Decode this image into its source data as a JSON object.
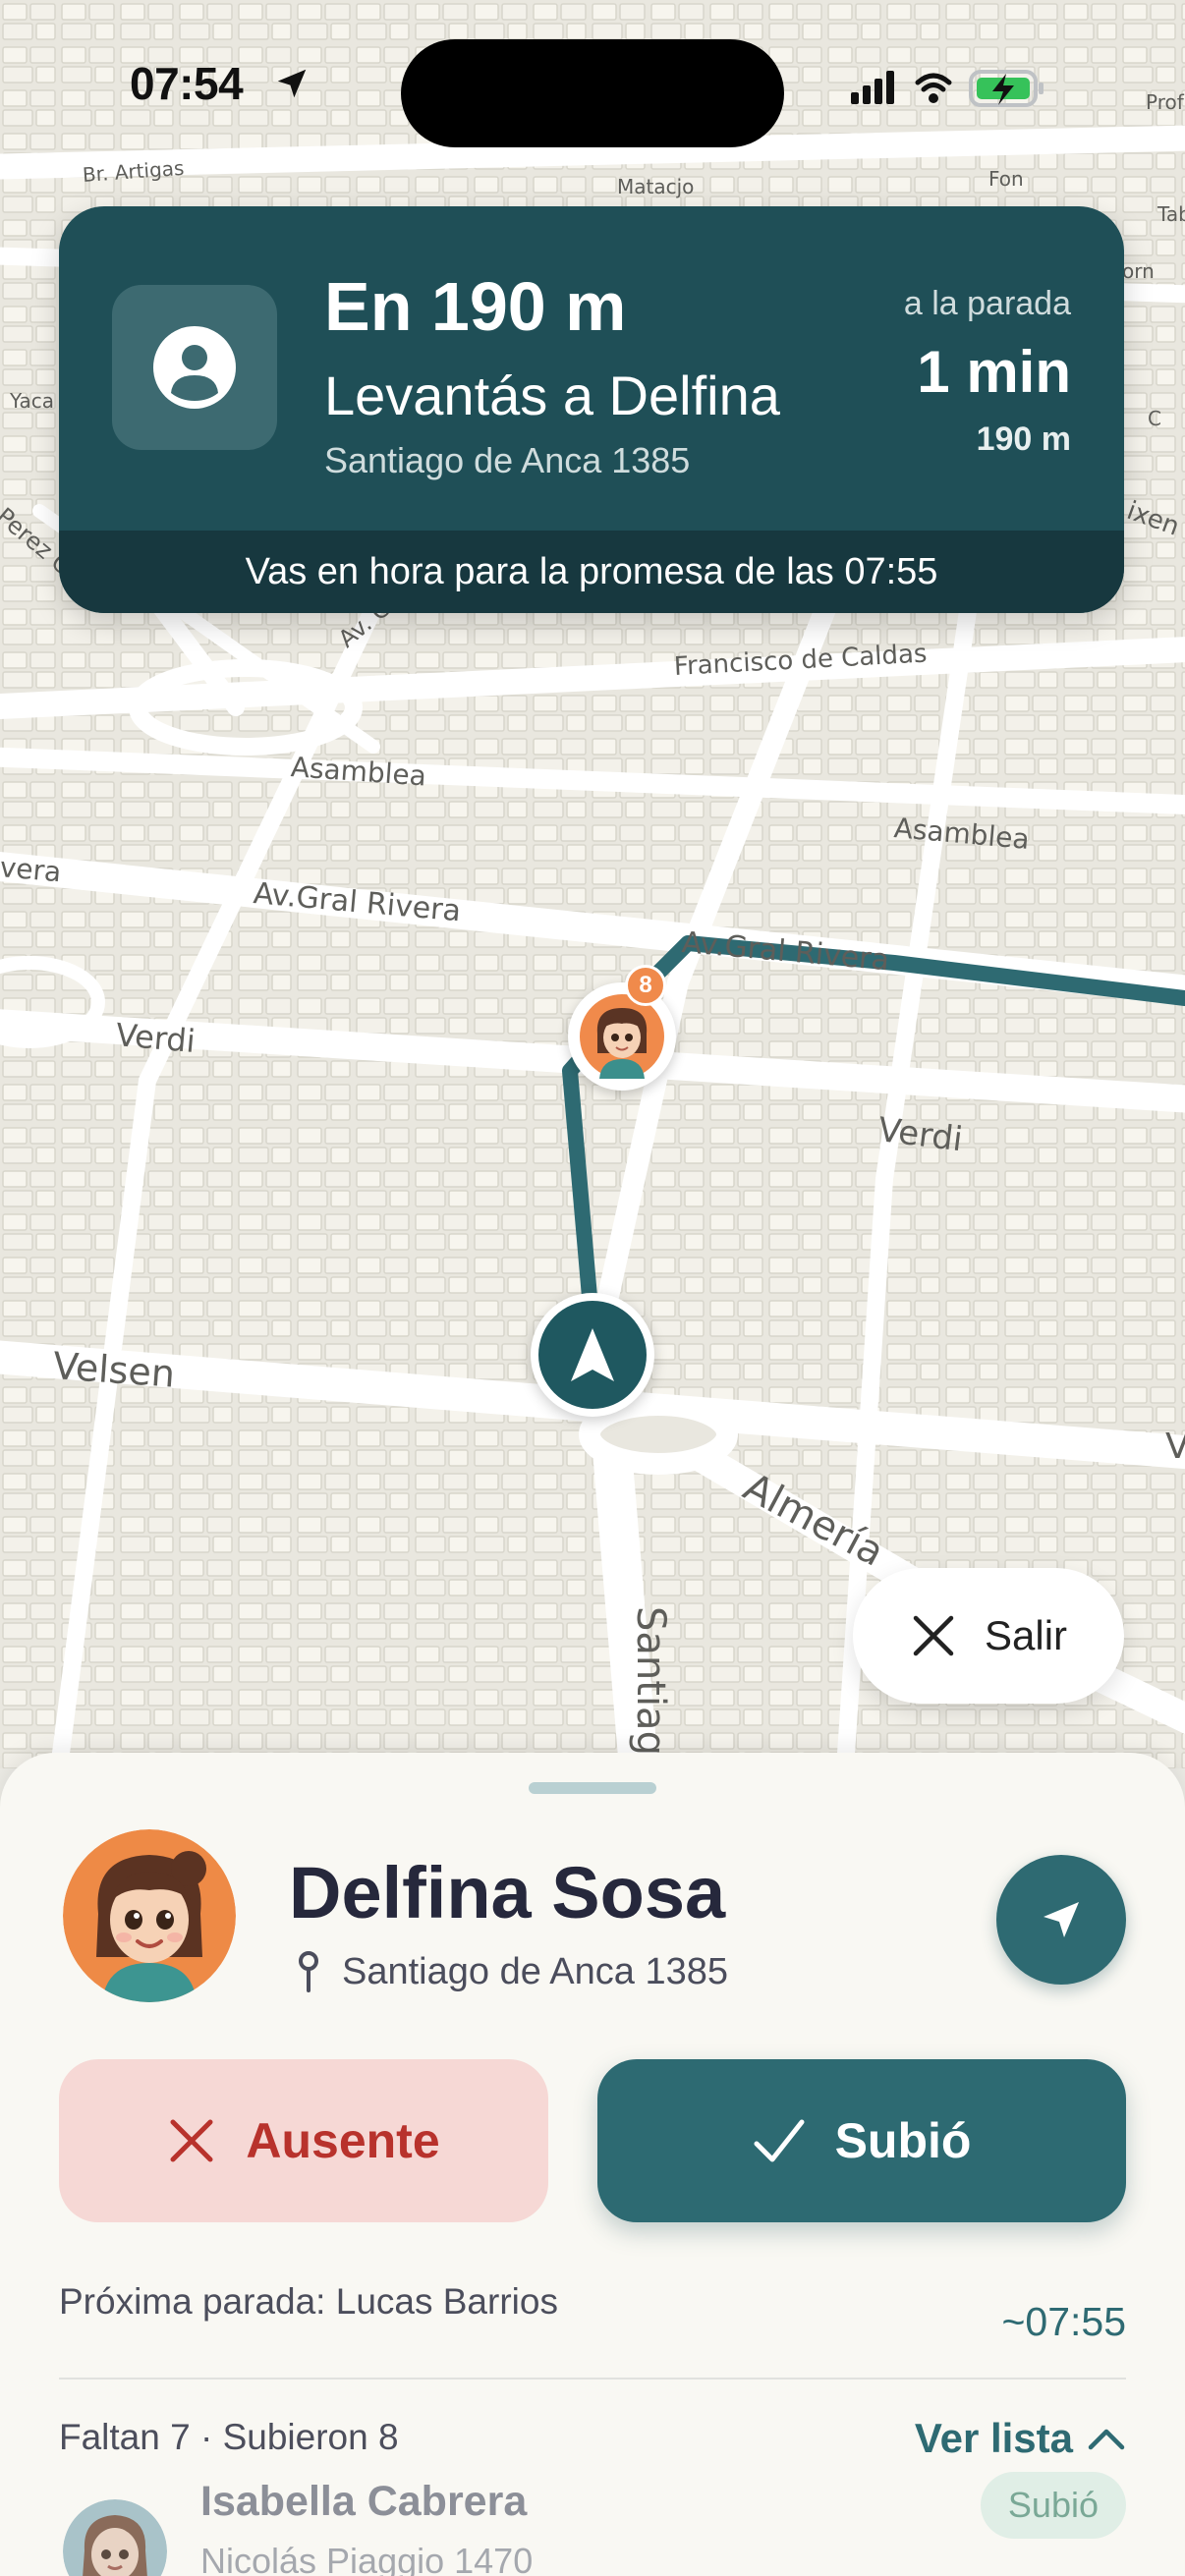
{
  "status_bar": {
    "time": "07:54"
  },
  "map": {
    "streets": [
      {
        "name": "Br. Artigas"
      },
      {
        "name": "Matacjo"
      },
      {
        "name": "Yaca"
      },
      {
        "name": "Perez C"
      },
      {
        "name": "orn"
      },
      {
        "name": "C"
      },
      {
        "name": "Tab"
      },
      {
        "name": "Fon"
      },
      {
        "name": "Prof"
      },
      {
        "name": "ixen"
      },
      {
        "name": "Av. C"
      },
      {
        "name": "Francisco de Caldas"
      },
      {
        "name": "Asamblea"
      },
      {
        "name": "Asamblea"
      },
      {
        "name": "vera"
      },
      {
        "name": "Av.Gral Rivera"
      },
      {
        "name": "Av.Gral Rivera"
      },
      {
        "name": "Verdi"
      },
      {
        "name": "Verdi"
      },
      {
        "name": "Velsen"
      },
      {
        "name": "Almería"
      },
      {
        "name": "Santiag"
      },
      {
        "name": "V"
      }
    ],
    "student_marker_badge": "8"
  },
  "nav_banner": {
    "distance": "En 190 m",
    "instruction": "Levantás a Delfina",
    "address": "Santiago de Anca 1385",
    "to_stop_label": "a la parada",
    "eta": "1 min",
    "eta_distance": "190 m",
    "footer": "Vas en hora para la promesa de las 07:55"
  },
  "exit_button": {
    "label": "Salir"
  },
  "sheet": {
    "student": {
      "name": "Delfina Sosa",
      "address": "Santiago de Anca 1385"
    },
    "actions": {
      "absent_label": "Ausente",
      "boarded_label": "Subió"
    },
    "next_stop": {
      "text": "Próxima parada: Lucas Barrios",
      "time": "~07:55"
    },
    "summary": {
      "counts": "Faltan 7 · Subieron 8",
      "view_list_label": "Ver lista"
    },
    "list": [
      {
        "name": "Isabella Cabrera",
        "address": "Nicolás Piaggio 1470",
        "status": "Subió"
      }
    ]
  },
  "colors": {
    "primary": "#2e6a72",
    "banner": "#1f4f57",
    "absent_bg": "#f6d8d5",
    "absent_text": "#b8322c",
    "badge_orange": "#f08a4b"
  }
}
